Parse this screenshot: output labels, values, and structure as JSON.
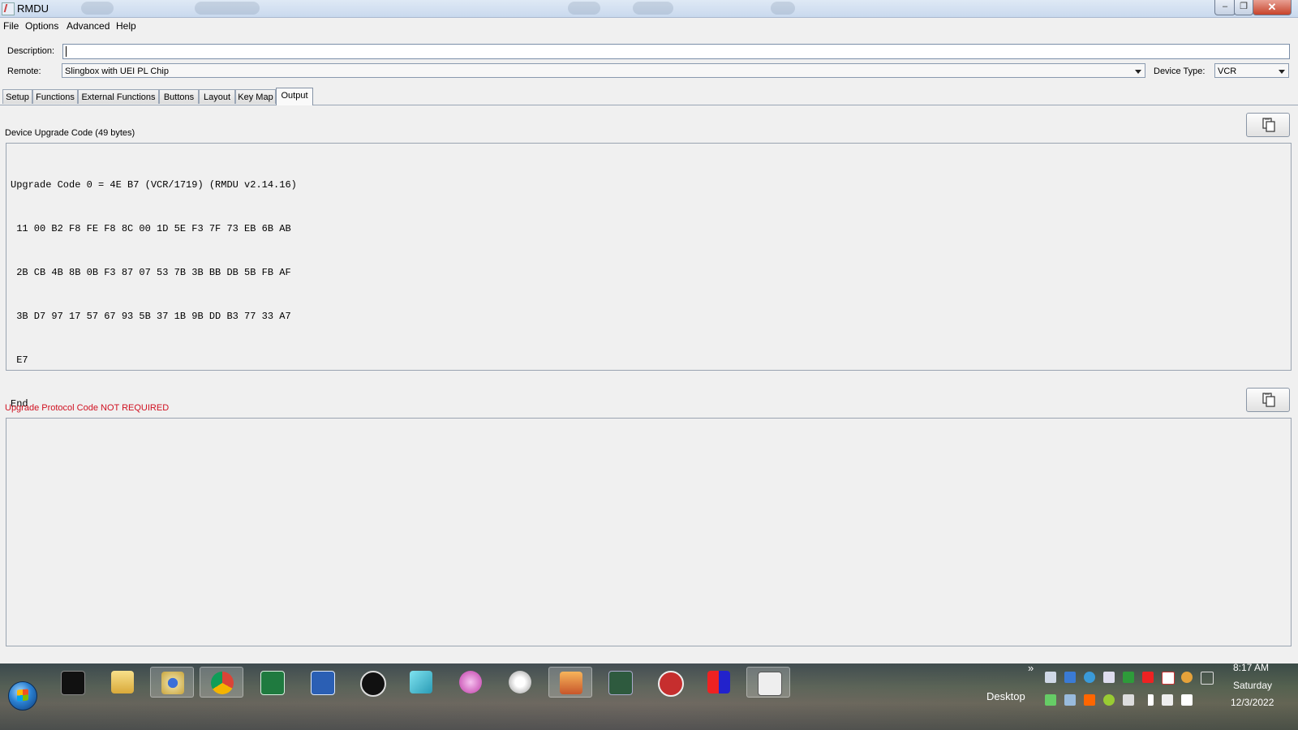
{
  "window": {
    "title": "RMDU",
    "controls": {
      "minimize": "–",
      "maximize": "❐",
      "close": "✕"
    }
  },
  "menu": [
    "File",
    "Options",
    "Advanced",
    "Help"
  ],
  "form": {
    "description_label": "Description:",
    "description_value": "",
    "remote_label": "Remote:",
    "remote_value": "Slingbox with UEI PL Chip",
    "device_type_label": "Device Type:",
    "device_type_value": "VCR"
  },
  "tabs": [
    "Setup",
    "Functions",
    "External Functions",
    "Buttons",
    "Layout",
    "Key Map",
    "Output"
  ],
  "active_tab": "Output",
  "upgrade": {
    "label": "Device Upgrade Code (49 bytes)",
    "code_lines": [
      "Upgrade Code 0 = 4E B7 (VCR/1719) (RMDU v2.14.16)",
      " 11 00 B2 F8 FE F8 8C 00 1D 5E F3 7F 73 EB 6B AB",
      " 2B CB 4B 8B 0B F3 87 07 53 7B 3B BB DB 5B FB AF",
      " 3B D7 97 17 57 67 93 5B 37 1B 9B DD B3 77 33 A7",
      " E7",
      "End"
    ]
  },
  "protocol": {
    "label": "Upgrade Protocol Code NOT REQUIRED",
    "label_color": "#d01020"
  },
  "icons": {
    "copy": "copy-icon"
  },
  "taskbar": {
    "desktop_label": "Desktop",
    "overflow": "»",
    "clock": {
      "time": "8:17 AM",
      "day": "Saturday",
      "date": "12/3/2022"
    }
  }
}
